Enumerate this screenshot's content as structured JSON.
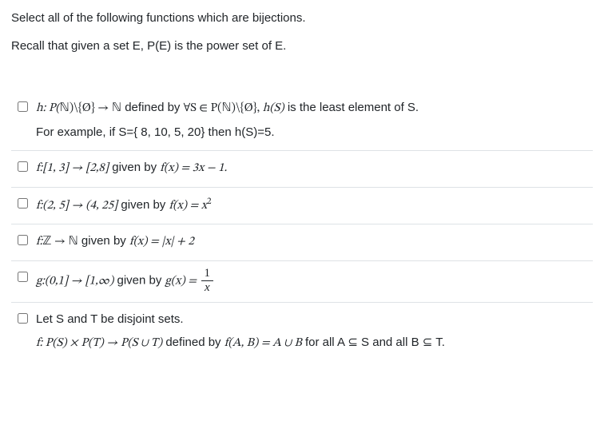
{
  "prompt": {
    "line1": "Select all of the following functions which are bijections.",
    "line2": "Recall that given a set E, P(E) is the power set of E."
  },
  "options": {
    "h": {
      "prefix": "h: P(",
      "nat1": "ℕ",
      "after_nat1": ")\\{Ø} → ",
      "nat2": "ℕ",
      "defined_by": " defined by ",
      "forall": "∀S ∈ P(",
      "nat3": "ℕ",
      "after_nat3": ")\\{Ø}, ",
      "hs": "h(S)",
      "tail": " is the least element of S.",
      "example": "For example, if S={ 8, 10, 5, 20} then h(S)=5."
    },
    "f1": {
      "lead": "f:[1, 3] → [2,8]",
      "given": " given by ",
      "eq": "f(x) = 3x − 1."
    },
    "f2": {
      "lead": "f:(2, 5] → (4, 25]",
      "given": " given by ",
      "eq_pre": "f(x) = x",
      "eq_sup": "2"
    },
    "f3": {
      "lead_pre": "f:",
      "z": "ℤ",
      "lead_mid": " → ",
      "n": "ℕ",
      "given": " given by ",
      "eq": "f(x) = |x| + 2"
    },
    "g": {
      "lead": "g:(0,1] → [1,∞)",
      "given": " given by ",
      "eq_pre": "g(x) = ",
      "num": "1",
      "den": "x"
    },
    "last": {
      "line1": "Let S and T be disjoint sets.",
      "line2_pre": "f: P(S) × P(T) → P(S ∪ T)",
      "line2_def": " defined by ",
      "line2_eq": "f(A, B)  =  A ∪ B",
      "line2_tail": " for all A ⊆ S and all B ⊆ T."
    }
  }
}
